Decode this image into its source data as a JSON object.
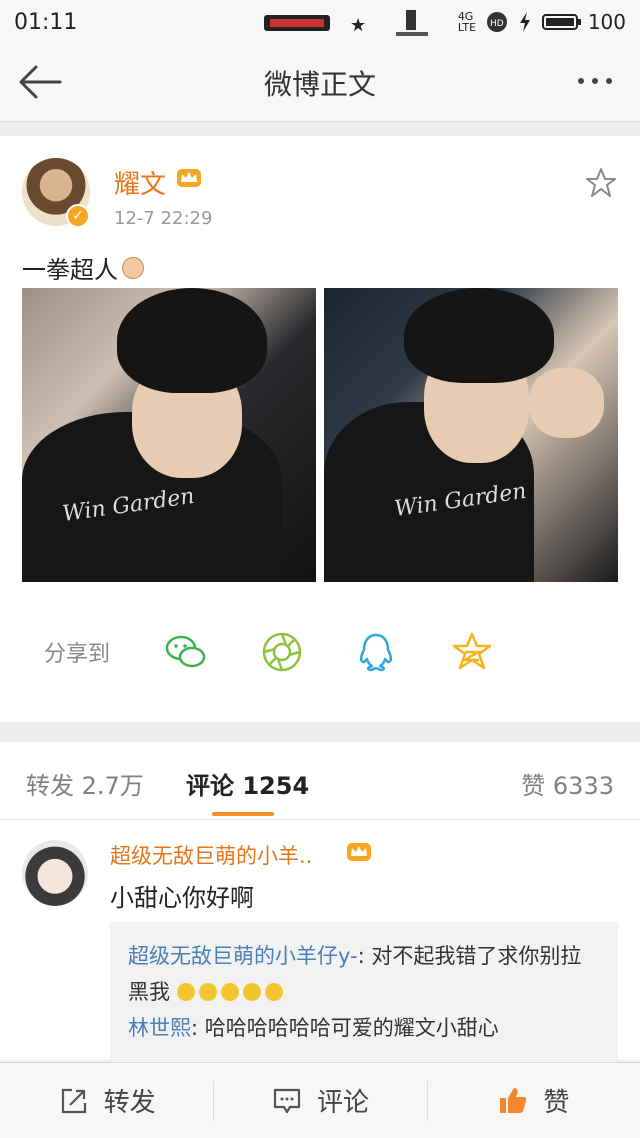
{
  "status_bar": {
    "time": "01:11",
    "network": "4G LTE",
    "battery": "100"
  },
  "nav": {
    "title": "微博正文"
  },
  "post": {
    "username": "耀文",
    "timestamp": "12-7 22:29",
    "text": "一拳超人",
    "photo1_logo": "Win Garden",
    "photo2_logo": "Win Garden",
    "share_label": "分享到",
    "share_targets": [
      "wechat-icon",
      "moments-icon",
      "qq-icon",
      "qzone-icon"
    ]
  },
  "tabs": {
    "repost": "转发 2.7万",
    "comment": "评论 1254",
    "like": "赞 6333"
  },
  "comment": {
    "name": "超级无敌巨萌的小羊..",
    "text": "小甜心你好啊",
    "replies": [
      {
        "name": "超级无敌巨萌的小羊仔y-",
        "text": ": 对不起我错了求你别拉黑我"
      },
      {
        "name": "林世熙",
        "text": ": 哈哈哈哈哈哈可爱的耀文小甜心"
      }
    ]
  },
  "bottom_bar": {
    "repost": "转发",
    "comment": "评论",
    "like": "赞"
  },
  "colors": {
    "accent": "#f59023",
    "username": "#e8761a",
    "link": "#4a7fb8"
  }
}
